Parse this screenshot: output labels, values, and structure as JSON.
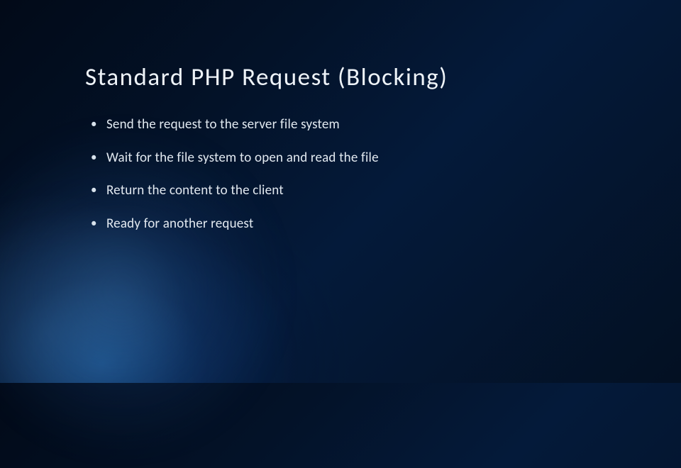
{
  "slide": {
    "title": "Standard PHP Request (Blocking)",
    "bullets": [
      "Send the request to the server file system",
      "Wait for the file system to open and read the file",
      "Return the content to the client",
      "Ready for another request"
    ]
  }
}
